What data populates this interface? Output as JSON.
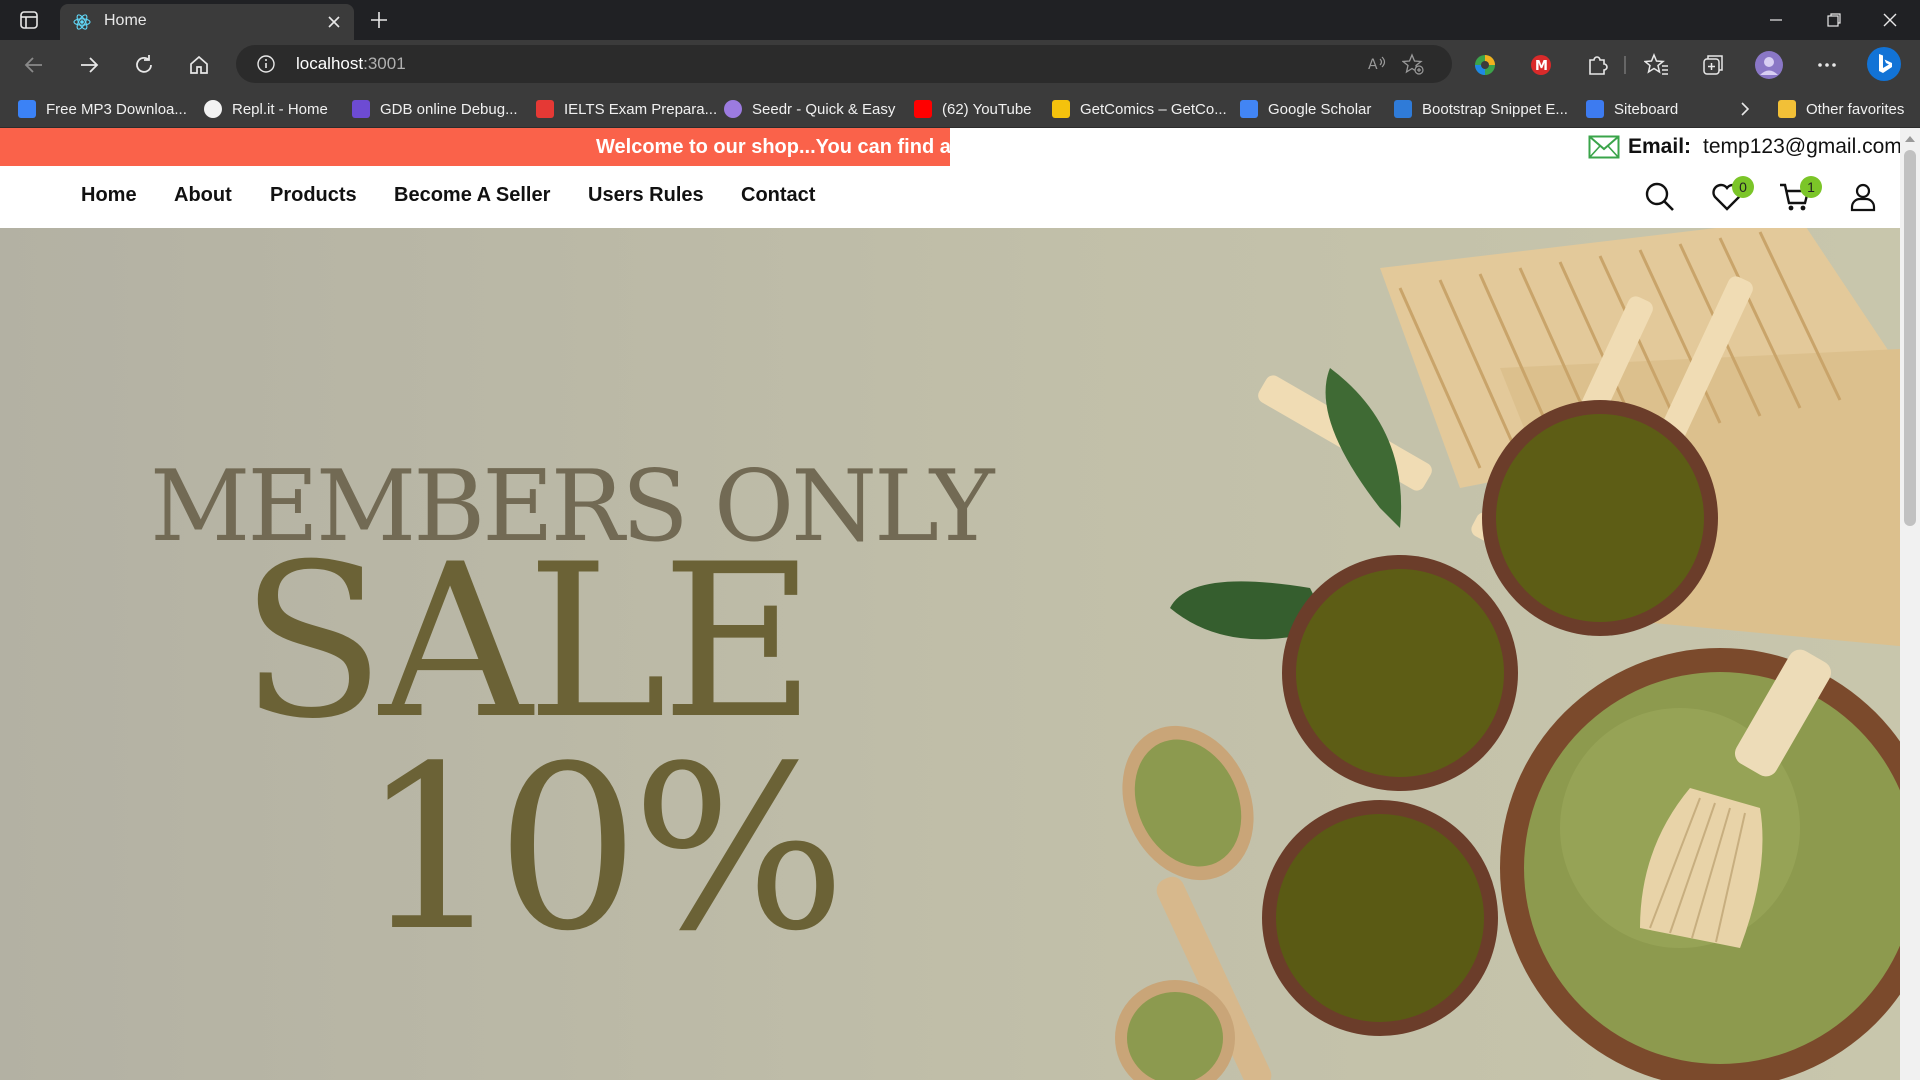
{
  "browser": {
    "tab": {
      "title": "Home"
    },
    "address": {
      "host": "localhost",
      "port": ":3001"
    },
    "bookmarks": [
      {
        "label": "Free MP3 Downloa...",
        "color": "#3b82f6"
      },
      {
        "label": "Repl.it - Home",
        "color": "#f2f2f2"
      },
      {
        "label": "GDB online Debug...",
        "color": "#6d4bd3"
      },
      {
        "label": "IELTS Exam Prepara...",
        "color": "#e53935"
      },
      {
        "label": "Seedr - Quick & Easy",
        "color": "#9c7be0"
      },
      {
        "label": "(62) YouTube",
        "color": "#ff0000"
      },
      {
        "label": "GetComics – GetCo...",
        "color": "#f4c20d"
      },
      {
        "label": "Google Scholar",
        "color": "#4285f4"
      },
      {
        "label": "Bootstrap Snippet E...",
        "color": "#2f7bd8"
      },
      {
        "label": "Siteboard",
        "color": "#3d7bf0"
      }
    ],
    "other_favorites": "Other favorites"
  },
  "topbar": {
    "marquee": "Welcome to our shop...You can find anyt",
    "email_label": "Email:",
    "email_value": "temp123@gmail.com"
  },
  "nav": {
    "links": [
      "Home",
      "About",
      "Products",
      "Become A Seller",
      "Users Rules",
      "Contact"
    ],
    "wishlist_count": "0",
    "cart_count": "1"
  },
  "hero": {
    "line1": "MEMBERS ONLY",
    "line2": "SALE",
    "line3": "10%"
  },
  "colors": {
    "marquee_bg": "#fa624a",
    "badge": "#7bc528",
    "hero_text": "#6b6236"
  }
}
